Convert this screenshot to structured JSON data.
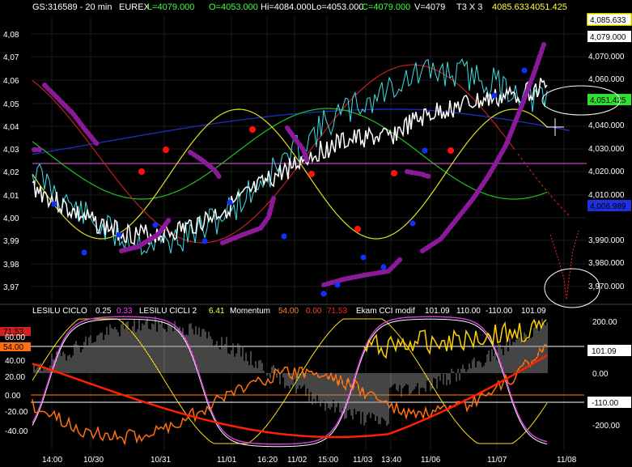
{
  "header": {
    "symbol": "GS:316589 - 20 min",
    "exchange": "EUREX",
    "last": "L=4079.000",
    "open": "O=4053.000",
    "high": "Hi=4084.000",
    "low": "Lo=4053.000",
    "close": "C=4079.000",
    "volume": "V=4079",
    "study": "T3 X 3",
    "t3_a": "4085.633",
    "t3_b": "4051.425"
  },
  "colors": {
    "price": "#ffffff",
    "cyan": "#40e0e8",
    "magenta_line": "#c040c0",
    "purple_dots": "#8a1a9a",
    "red_ma": "#c02020",
    "green_ma": "#20c020",
    "blue_ma": "#2030d0",
    "yellow_ma": "#e0e020",
    "red_dot": "#ff1010",
    "blue_dot": "#1030ff",
    "orange": "#ff7010",
    "yellow_cci": "#ffe010",
    "momentum_red": "#ff2000"
  },
  "price_axis": {
    "left_labels": [
      "4,08",
      "4,07",
      "4,06",
      "4,05",
      "4,04",
      "4,03",
      "4,02",
      "4,01",
      "4,00",
      "3,99",
      "3,98",
      "3,97"
    ],
    "right_labels": [
      "4,070.000",
      "4,060.000",
      "4,040.000",
      "4,030.000",
      "4,020.000",
      "4,010.000",
      "3,990.000",
      "3,980.000",
      "3,970.000"
    ],
    "badges": [
      {
        "value": "4,085.633",
        "style": "yellow-box"
      },
      {
        "value": "4,079.000",
        "style": "white-box"
      },
      {
        "value": "4,051.425",
        "style": "green-box"
      },
      {
        "value": "4,006.989",
        "style": "blue-box"
      }
    ]
  },
  "indicator_header": {
    "items": [
      {
        "text": "LESILU CICLO",
        "color": "#ffffff"
      },
      {
        "text": "0.25",
        "color": "#ffffff"
      },
      {
        "text": "0.33",
        "color": "#ff40ff"
      },
      {
        "text": "LESILU CICLI 2",
        "color": "#ffffff"
      },
      {
        "text": "6.41",
        "color": "#ffff40"
      },
      {
        "text": "Momentum",
        "color": "#ffffff"
      },
      {
        "text": "54.00",
        "color": "#ff8020"
      },
      {
        "text": "0.00",
        "color": "#ff4020"
      },
      {
        "text": "71.53",
        "color": "#ff2020"
      },
      {
        "text": "Ekam CCI modif",
        "color": "#ffffff"
      },
      {
        "text": "101.09",
        "color": "#ffffff"
      },
      {
        "text": "110.00",
        "color": "#ffffff"
      },
      {
        "text": "-110.00",
        "color": "#ffffff"
      },
      {
        "text": "101.09",
        "color": "#ffffff"
      }
    ]
  },
  "indicator_axis": {
    "left_labels": [
      "60.00",
      "40.00",
      "20.00",
      "0.00",
      "-20.00",
      "-40.00"
    ],
    "left_badges": [
      {
        "value": "71.53",
        "color": "#d02020"
      },
      {
        "value": "54.00",
        "color": "#ff7010"
      }
    ],
    "right_labels": [
      "200.00",
      "0.00",
      "-200.00"
    ],
    "right_badges": [
      {
        "value": "101.09",
        "style": "white-box"
      },
      {
        "value": "-110.00",
        "style": "white-box"
      }
    ]
  },
  "time_axis": [
    "14:00",
    "10/30",
    "10/31",
    "11/01",
    "16:20",
    "11/02",
    "15:00",
    "11/03",
    "13:40",
    "11/06",
    "11/07",
    "11/08"
  ]
}
